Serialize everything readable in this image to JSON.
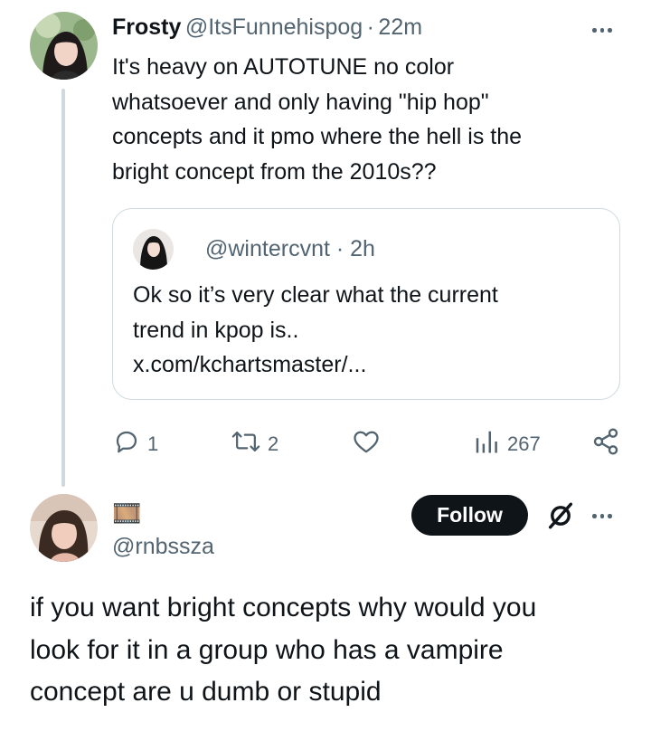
{
  "tweet": {
    "display_name": "Frosty",
    "handle": "@ItsFunnehispog",
    "separator": "·",
    "time": "22m",
    "text_lines": [
      "It's heavy on AUTOTUNE no color",
      "whatsoever and only having \"hip hop\"",
      "concepts and it pmo where the hell is the",
      "bright concept from the 2010s??"
    ],
    "quote": {
      "handle": "@wintercvnt",
      "separator": "·",
      "time": "2h",
      "text_lines": [
        "Ok so it’s very clear what the current",
        "trend in kpop is..",
        "x.com/kchartsmaster/..."
      ]
    },
    "actions": {
      "replies": "1",
      "reposts": "2",
      "views": "267"
    }
  },
  "reply": {
    "display_name_emoji": "🎞️",
    "handle": "@rnbssza",
    "follow_label": "Follow",
    "text_lines": [
      "if you want bright concepts why would you",
      "look for it in a group who has a vampire",
      "concept are u dumb or stupid"
    ]
  },
  "colors": {
    "text": "#0f1419",
    "muted": "#536471",
    "border": "#cfd9de",
    "follow_bg": "#0f1419"
  },
  "icons": [
    "reply-icon",
    "repost-icon",
    "like-icon",
    "views-icon",
    "share-icon",
    "grok-icon",
    "more-icon"
  ]
}
